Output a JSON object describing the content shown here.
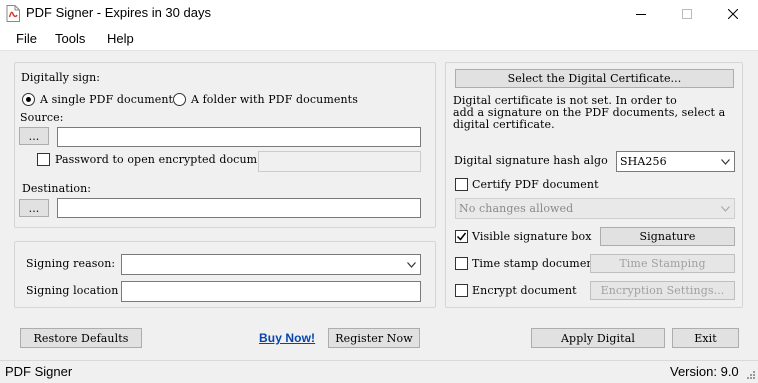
{
  "window": {
    "title": "PDF Signer - Expires in 30 days"
  },
  "menu": [
    "File",
    "Tools",
    "Help"
  ],
  "sign": {
    "heading": "Digitally sign:",
    "radio_single": "A single PDF document",
    "radio_folder": "A folder with PDF documents",
    "source_label": "Source:",
    "browse_label": "...",
    "source_value": "",
    "password_label": "Password to open encrypted documer",
    "password_value": "",
    "destination_label": "Destination:",
    "destination_value": ""
  },
  "reason": {
    "signing_reason_label": "Signing reason:",
    "signing_reason_value": "",
    "signing_location_label": "Signing location",
    "signing_location_value": ""
  },
  "cert": {
    "select_button": "Select the Digital Certificate...",
    "message": [
      "Digital certificate is not set. In order to",
      "add a signature on the PDF documents, select a",
      "digital certificate."
    ],
    "hash_label": "Digital signature hash algo",
    "hash_value": "SHA256",
    "certify_label": "Certify PDF document",
    "certify_option": "No changes allowed",
    "visible_label": "Visible signature box",
    "visible_button": "Signature",
    "timestamp_label": "Time stamp document",
    "timestamp_button": "Time Stamping",
    "encrypt_label": "Encrypt document",
    "encrypt_button": "Encryption Settings..."
  },
  "actions": {
    "restore": "Restore Defaults",
    "buy": "Buy Now!",
    "register": "Register Now",
    "apply": "Apply Digital",
    "exit": "Exit"
  },
  "status": {
    "left": "PDF Signer",
    "right": "Version: 9.0"
  },
  "colors": {
    "link": "#0645ad",
    "window_bg": "#f0f0f0"
  }
}
